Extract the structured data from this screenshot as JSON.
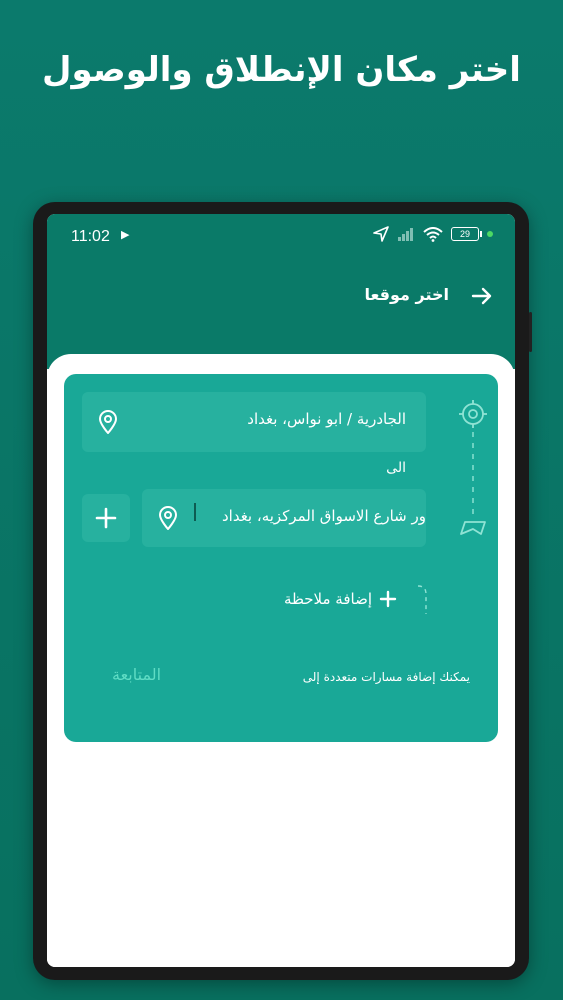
{
  "promo": {
    "title": "اختر مكان الإنطلاق والوصول"
  },
  "status_bar": {
    "time": "11:02",
    "battery": "29"
  },
  "toolbar": {
    "title": "اختر موقعا"
  },
  "route": {
    "from_value": "الجادرية / ابو نواس، بغداد",
    "to_label": "الى",
    "to_value": "ور شارع الاسواق المركزيه، بغداد",
    "add_note_label": "إضافة ملاحظة",
    "hint": "يمكنك إضافة مسارات متعددة إلى",
    "continue_label": "المتابعة"
  },
  "icons": {
    "back": "arrow-right-icon",
    "pin": "location-pin-icon",
    "plus": "plus-icon",
    "origin": "crosshair-icon",
    "destination": "navigation-icon"
  },
  "colors": {
    "brand": "#0a7a68",
    "card": "#19a897",
    "field": "#27b19f",
    "accent": "#5fdcc4"
  }
}
